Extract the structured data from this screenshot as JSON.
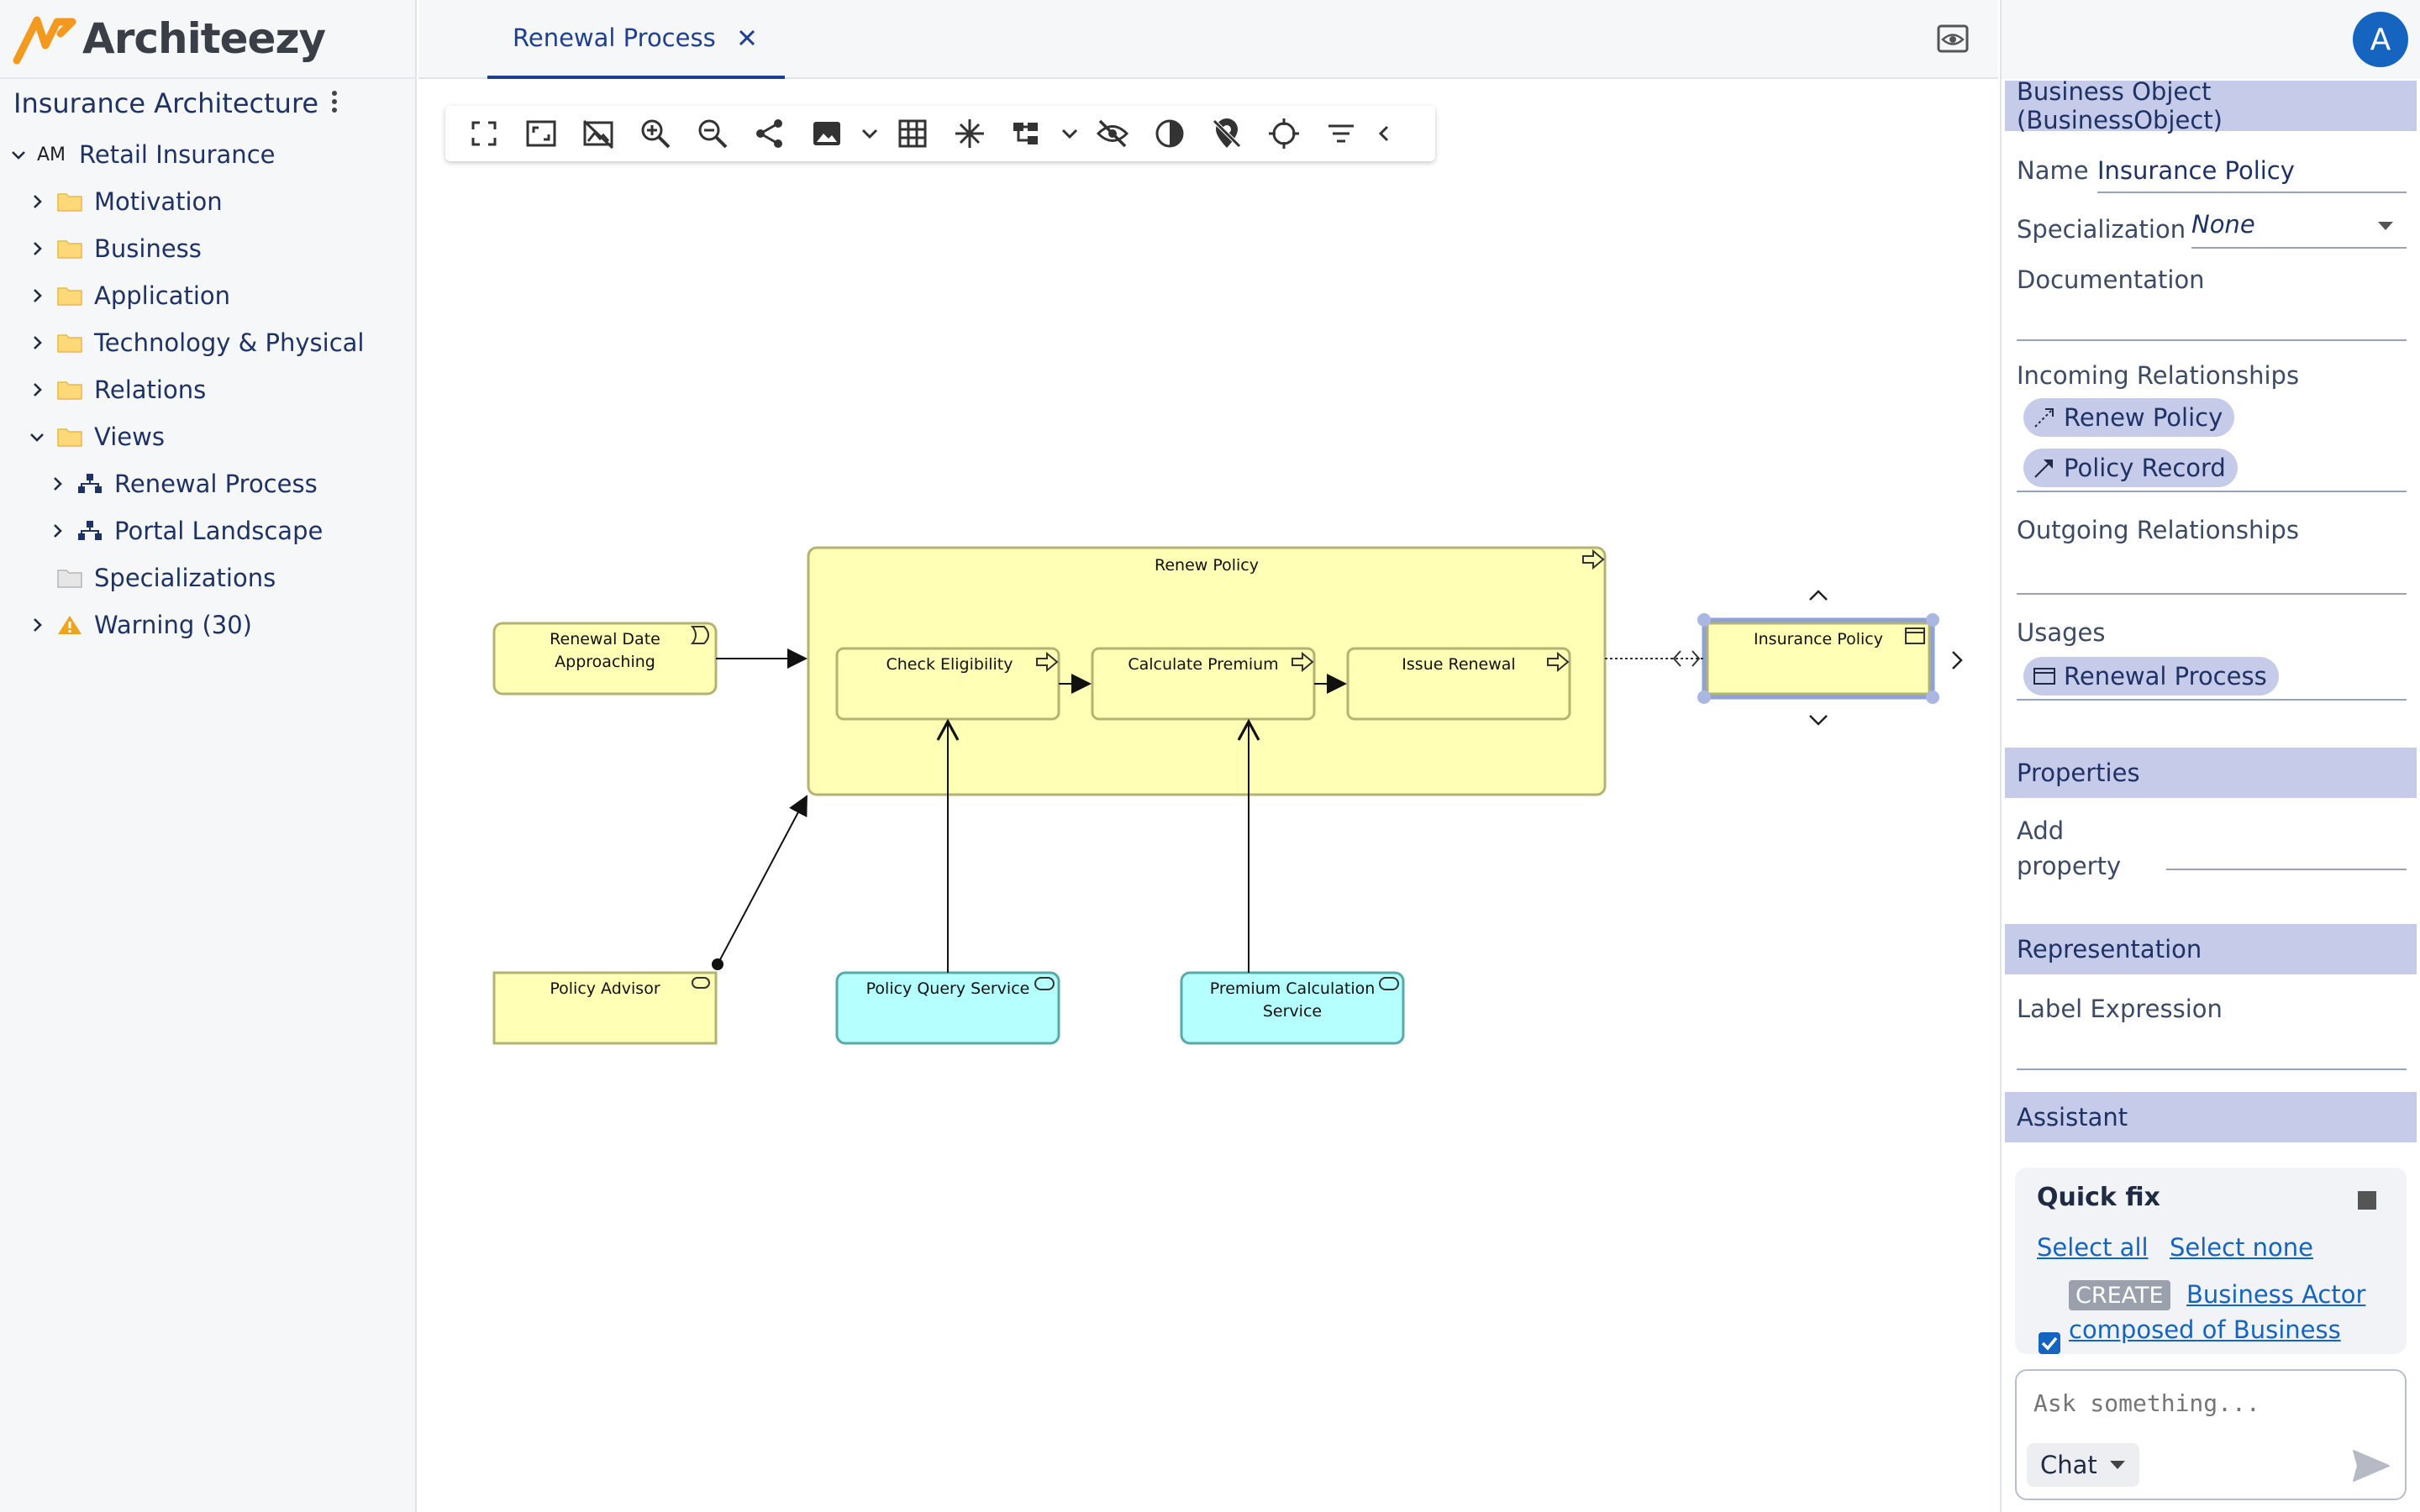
{
  "app": {
    "brand": "Architeezy",
    "brand_color": "#f39a1e"
  },
  "sidebar": {
    "project_title": "Insurance Architecture",
    "model": {
      "badge": "AM",
      "label": "Retail Insurance"
    },
    "items": [
      {
        "label": "Motivation",
        "icon": "folder-icon"
      },
      {
        "label": "Business",
        "icon": "folder-icon"
      },
      {
        "label": "Application",
        "icon": "folder-icon"
      },
      {
        "label": "Technology & Physical",
        "icon": "folder-icon"
      },
      {
        "label": "Relations",
        "icon": "folder-icon"
      },
      {
        "label": "Views",
        "icon": "folder-icon",
        "expanded": true
      },
      {
        "label": "Renewal Process",
        "icon": "view-diagram-icon",
        "indent": 1
      },
      {
        "label": "Portal Landscape",
        "icon": "view-diagram-icon",
        "indent": 1
      },
      {
        "label": "Specializations",
        "icon": "grey-folder-icon"
      },
      {
        "label": "Warning (30)",
        "icon": "warning-icon"
      }
    ]
  },
  "tabs": [
    {
      "label": "Renewal Process",
      "active": true
    }
  ],
  "diagram": {
    "container": {
      "label": "Renew Policy"
    },
    "processes": [
      "Check Eligibility",
      "Calculate Premium",
      "Issue Renewal"
    ],
    "event": {
      "line1": "Renewal Date",
      "line2": "Approaching"
    },
    "actor_role": {
      "label": "Policy Advisor"
    },
    "services": [
      {
        "line1": "Policy Query Service",
        "line2": ""
      },
      {
        "line1": "Premium Calculation",
        "line2": "Service"
      }
    ],
    "object": {
      "label": "Insurance Policy"
    },
    "colors": {
      "business": "#ffffb5",
      "business_border": "#b3b373",
      "application": "#b5ffff",
      "application_border": "#5aa9a9",
      "selection": "#8ea2d9"
    }
  },
  "panel": {
    "element_type": "Business Object (BusinessObject)",
    "name_label": "Name",
    "name_value": "Insurance Policy",
    "specialization_label": "Specialization",
    "specialization_value": "None",
    "documentation_label": "Documentation",
    "incoming_label": "Incoming Relationships",
    "incoming": [
      "Renew Policy",
      "Policy Record"
    ],
    "outgoing_label": "Outgoing Relationships",
    "usages_label": "Usages",
    "usages": [
      "Renewal Process"
    ],
    "properties_header": "Properties",
    "add_property_line1": "Add",
    "add_property_line2": "property",
    "representation_header": "Representation",
    "label_expression_label": "Label Expression",
    "assistant_header": "Assistant",
    "avatar_letter": "A",
    "avatar_color": "#1565c0"
  },
  "assistant": {
    "quick_fix_title": "Quick fix",
    "select_all": "Select all",
    "select_none": "Select none",
    "create_tag": "CREATE",
    "fix_line1": "Business Actor",
    "fix_line2": "composed of Business",
    "chat_placeholder": "Ask something...",
    "chat_mode": "Chat"
  }
}
